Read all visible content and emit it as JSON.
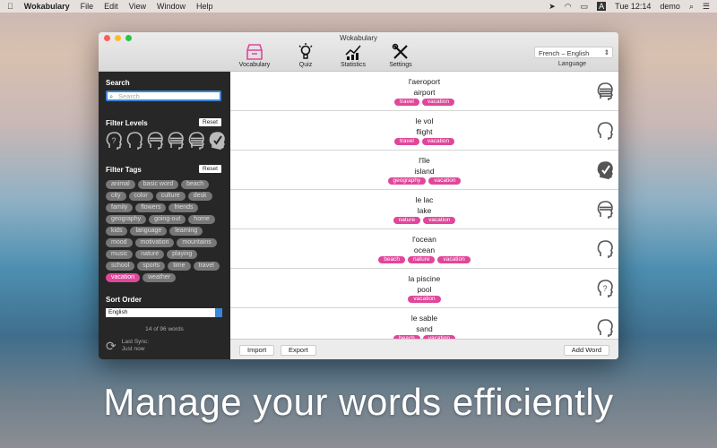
{
  "menubar": {
    "app": "Wokabulary",
    "items": [
      "File",
      "Edit",
      "View",
      "Window",
      "Help"
    ],
    "time": "Tue 12:14",
    "user": "demo",
    "input_source": "A"
  },
  "window": {
    "title": "Wokabulary"
  },
  "toolbar": {
    "items": [
      {
        "label": "Vocabulary"
      },
      {
        "label": "Quiz"
      },
      {
        "label": "Statistics"
      },
      {
        "label": "Settings"
      }
    ],
    "language_value": "French – English",
    "language_label": "Language"
  },
  "sidebar": {
    "search_label": "Search",
    "search_placeholder": "Search",
    "filter_levels_label": "Filter Levels",
    "reset": "Reset",
    "filter_tags_label": "Filter Tags",
    "tags": [
      "animal",
      "basic word",
      "beach",
      "city",
      "color",
      "culture",
      "desk",
      "family",
      "flowers",
      "friends",
      "geography",
      "going-out",
      "home",
      "kids",
      "language",
      "learning",
      "mood",
      "motivation",
      "mountains",
      "music",
      "nature",
      "playing",
      "school",
      "sports",
      "time",
      "travel",
      "vacation",
      "weather"
    ],
    "selected_tag": "vacation",
    "sort_label": "Sort Order",
    "sort_value": "English",
    "count": "14 of 96 words",
    "sync_label": "Last Sync:",
    "sync_value": "Just now"
  },
  "words": [
    {
      "fr": "l'aeroport",
      "en": "airport",
      "tags": [
        "travel",
        "vacation"
      ],
      "level": 4
    },
    {
      "fr": "le vol",
      "en": "flight",
      "tags": [
        "travel",
        "vacation"
      ],
      "level": 1
    },
    {
      "fr": "l'île",
      "en": "island",
      "tags": [
        "geography",
        "vacation"
      ],
      "level": 5
    },
    {
      "fr": "le lac",
      "en": "lake",
      "tags": [
        "nature",
        "vacation"
      ],
      "level": 2
    },
    {
      "fr": "l'ocean",
      "en": "ocean",
      "tags": [
        "beach",
        "nature",
        "vacation"
      ],
      "level": 1
    },
    {
      "fr": "la piscine",
      "en": "pool",
      "tags": [
        "vacation"
      ],
      "level": 0
    },
    {
      "fr": "le sable",
      "en": "sand",
      "tags": [
        "beach",
        "vacation"
      ],
      "level": 1
    }
  ],
  "buttons": {
    "import": "Import",
    "export": "Export",
    "add_word": "Add Word"
  },
  "caption": "Manage your words efficiently",
  "colors": {
    "accent": "#e0479a",
    "sidebar": "#272727"
  }
}
